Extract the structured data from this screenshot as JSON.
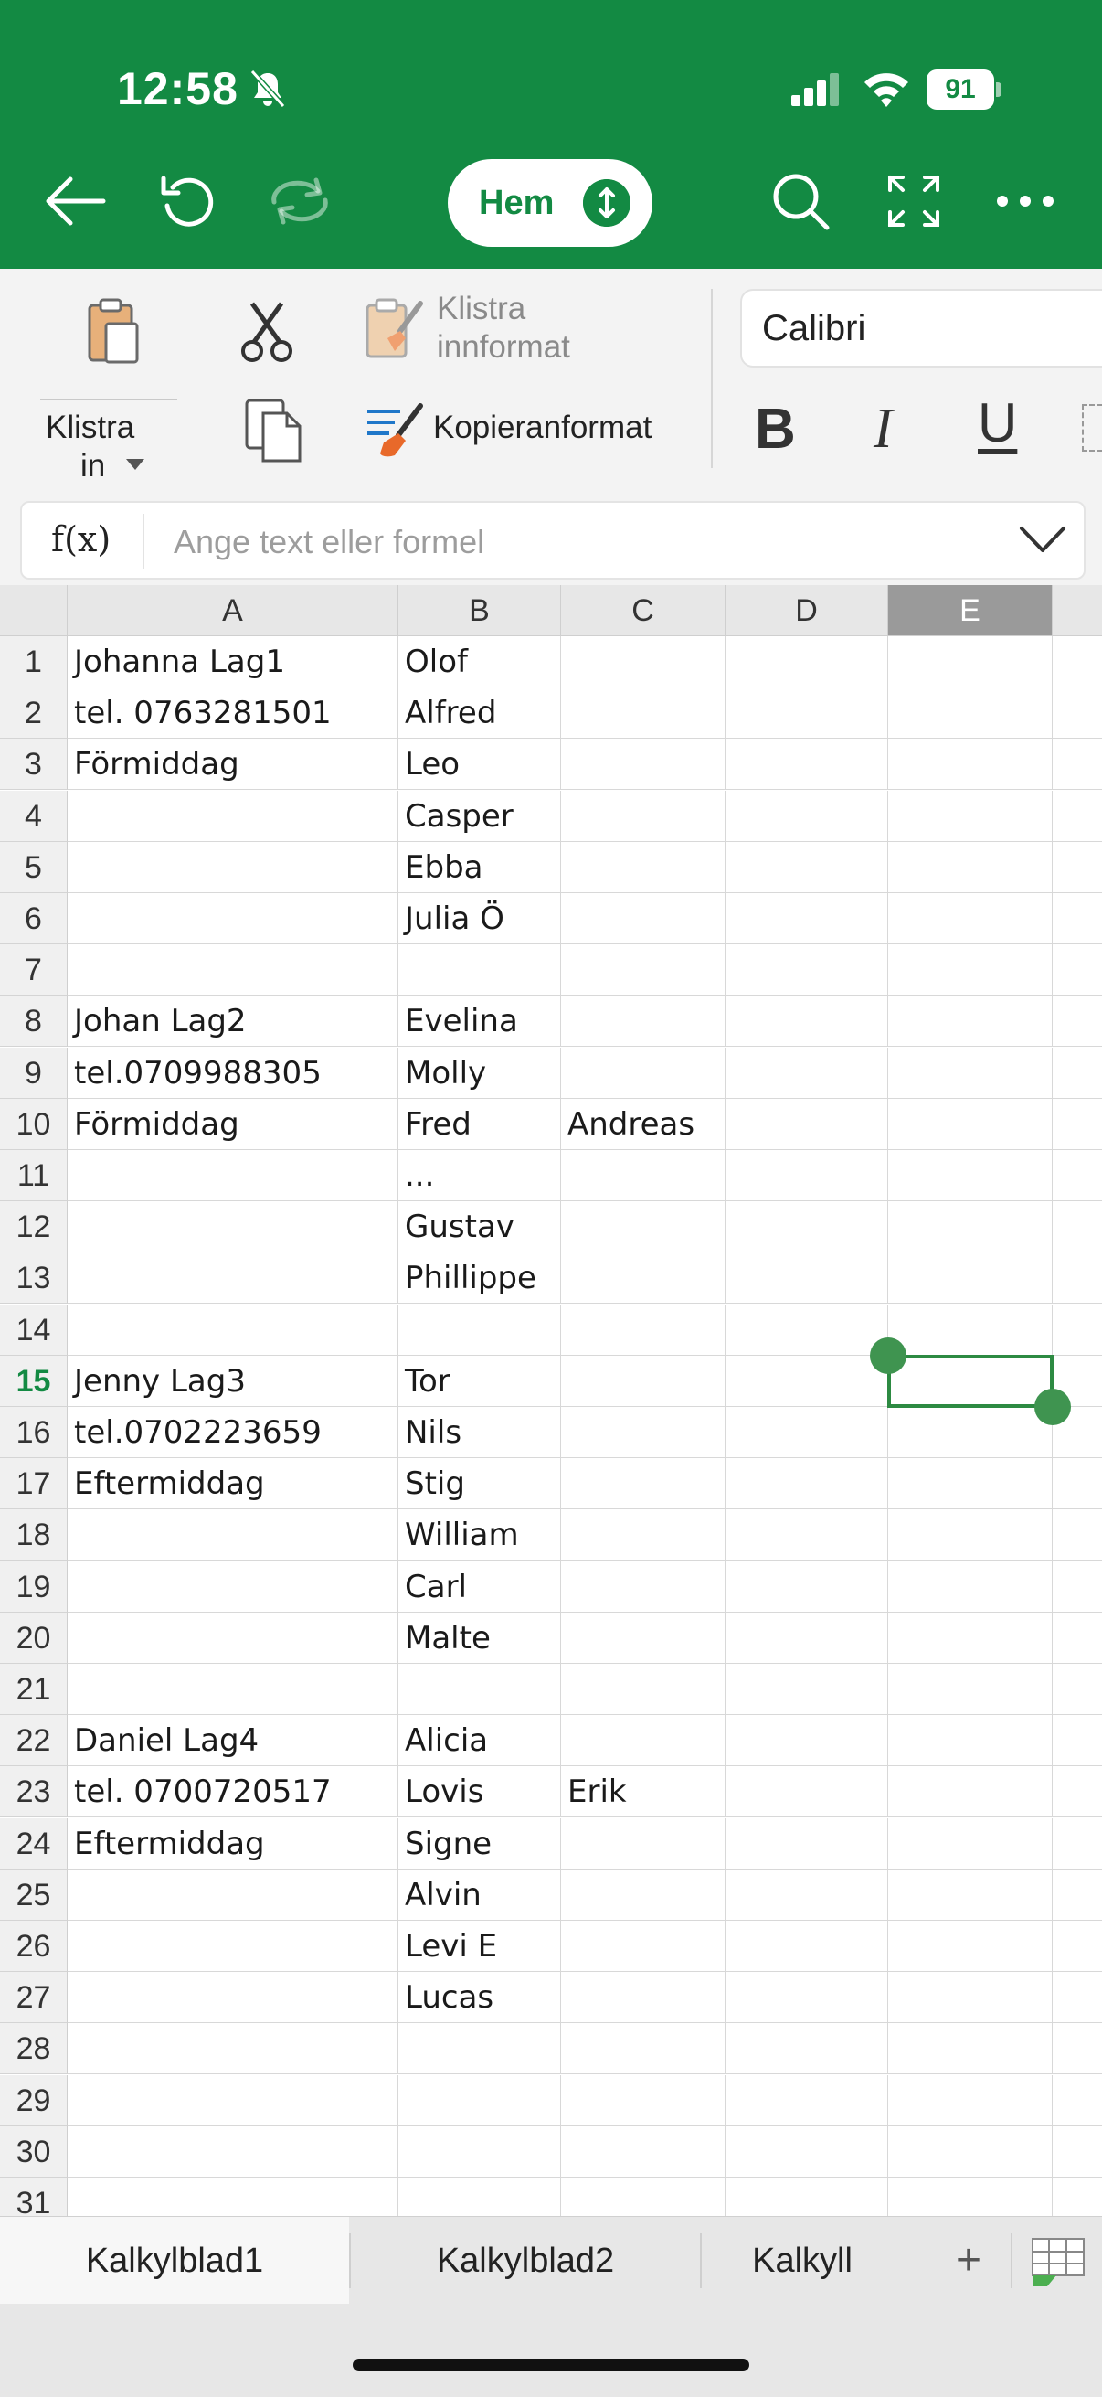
{
  "status": {
    "time": "12:58",
    "battery": "91"
  },
  "toolbar": {
    "mode_label": "Hem"
  },
  "ribbon": {
    "paste_label_1": "Klistra",
    "paste_label_2": "in",
    "paste_format_1": "Klistra",
    "paste_format_2": "innformat",
    "copy_format": "Kopieranformat",
    "font": "Calibri",
    "bold": "B",
    "italic": "I",
    "underline": "U"
  },
  "formula_bar": {
    "fx": "f(x)",
    "placeholder": "Ange text eller formel"
  },
  "columns": [
    "A",
    "B",
    "C",
    "D",
    "E"
  ],
  "selected_column": "E",
  "selected_row": 15,
  "rows": [
    {
      "n": "1",
      "A": "Johanna Lag1",
      "B": "Olof",
      "C": ""
    },
    {
      "n": "2",
      "A": "tel. 0763281501",
      "B": "Alfred",
      "C": ""
    },
    {
      "n": "3",
      "A": "Förmiddag",
      "B": "Leo",
      "C": ""
    },
    {
      "n": "4",
      "A": "",
      "B": "Casper",
      "C": ""
    },
    {
      "n": "5",
      "A": "",
      "B": "Ebba",
      "C": ""
    },
    {
      "n": "6",
      "A": "",
      "B": "Julia Ö",
      "C": ""
    },
    {
      "n": "7",
      "A": "",
      "B": "",
      "C": ""
    },
    {
      "n": "8",
      "A": "Johan Lag2",
      "B": "Evelina",
      "C": ""
    },
    {
      "n": "9",
      "A": "tel.0709988305",
      "B": "Molly",
      "C": ""
    },
    {
      "n": "10",
      "A": "Förmiddag",
      "B": "Fred",
      "C": "Andreas"
    },
    {
      "n": "11",
      "A": "",
      "B": "...",
      "C": ""
    },
    {
      "n": "12",
      "A": "",
      "B": "Gustav",
      "C": ""
    },
    {
      "n": "13",
      "A": "",
      "B": "Phillippe",
      "C": ""
    },
    {
      "n": "14",
      "A": "",
      "B": "",
      "C": ""
    },
    {
      "n": "15",
      "A": "Jenny Lag3",
      "B": "Tor",
      "C": ""
    },
    {
      "n": "16",
      "A": "tel.0702223659",
      "B": "Nils",
      "C": ""
    },
    {
      "n": "17",
      "A": "Eftermiddag",
      "B": "Stig",
      "C": ""
    },
    {
      "n": "18",
      "A": "",
      "B": "William",
      "C": ""
    },
    {
      "n": "19",
      "A": "",
      "B": "Carl",
      "C": ""
    },
    {
      "n": "20",
      "A": "",
      "B": "Malte",
      "C": ""
    },
    {
      "n": "21",
      "A": "",
      "B": "",
      "C": ""
    },
    {
      "n": "22",
      "A": "Daniel Lag4",
      "B": "Alicia",
      "C": ""
    },
    {
      "n": "23",
      "A": "tel. 0700720517",
      "B": "Lovis",
      "C": "Erik"
    },
    {
      "n": "24",
      "A": "Eftermiddag",
      "B": "Signe",
      "C": ""
    },
    {
      "n": "25",
      "A": "",
      "B": "Alvin",
      "C": ""
    },
    {
      "n": "26",
      "A": "",
      "B": "Levi E",
      "C": ""
    },
    {
      "n": "27",
      "A": "",
      "B": "Lucas",
      "C": ""
    },
    {
      "n": "28",
      "A": "",
      "B": "",
      "C": ""
    },
    {
      "n": "29",
      "A": "",
      "B": "",
      "C": ""
    },
    {
      "n": "30",
      "A": "",
      "B": "",
      "C": ""
    },
    {
      "n": "31",
      "A": "",
      "B": "",
      "C": ""
    }
  ],
  "sheets": [
    "Kalkylblad1",
    "Kalkylblad2",
    "Kalkyll"
  ],
  "add_sheet": "+",
  "colors": {
    "accent": "#138a43",
    "selection": "#2d8a42"
  }
}
